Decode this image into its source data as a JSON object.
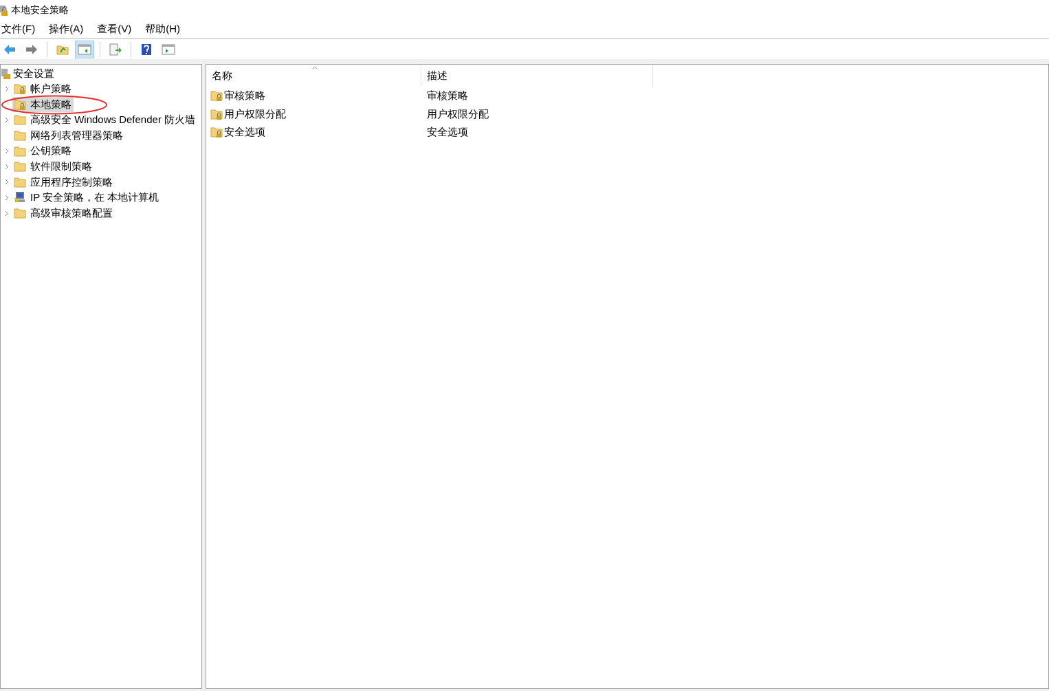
{
  "window": {
    "title": "本地安全策略"
  },
  "menu": [
    "文件(F)",
    "操作(A)",
    "查看(V)",
    "帮助(H)"
  ],
  "toolbar": [
    {
      "kind": "back",
      "selected": false
    },
    {
      "kind": "forward",
      "selected": false
    },
    {
      "kind": "sep"
    },
    {
      "kind": "up",
      "selected": false
    },
    {
      "kind": "tree",
      "selected": true
    },
    {
      "kind": "sep"
    },
    {
      "kind": "export",
      "selected": false
    },
    {
      "kind": "sep"
    },
    {
      "kind": "help",
      "selected": false
    },
    {
      "kind": "pane",
      "selected": false
    }
  ],
  "tree": {
    "label": "安全设置",
    "children": [
      {
        "label": "帐户策略",
        "kind": "locked",
        "expandable": true,
        "selected": false,
        "circled": false
      },
      {
        "label": "本地策略",
        "kind": "locked",
        "expandable": false,
        "selected": true,
        "circled": true
      },
      {
        "label": "高级安全 Windows Defender 防火墙",
        "kind": "folder",
        "expandable": true,
        "selected": false,
        "circled": false
      },
      {
        "label": "网络列表管理器策略",
        "kind": "folder",
        "expandable": false,
        "selected": false,
        "circled": false
      },
      {
        "label": "公钥策略",
        "kind": "folder",
        "expandable": true,
        "selected": false,
        "circled": false
      },
      {
        "label": "软件限制策略",
        "kind": "folder",
        "expandable": true,
        "selected": false,
        "circled": false
      },
      {
        "label": "应用程序控制策略",
        "kind": "folder",
        "expandable": true,
        "selected": false,
        "circled": false
      },
      {
        "label": "IP 安全策略，在 本地计算机",
        "kind": "computer",
        "expandable": true,
        "selected": false,
        "circled": false
      },
      {
        "label": "高级审核策略配置",
        "kind": "folder",
        "expandable": true,
        "selected": false,
        "circled": false
      }
    ]
  },
  "table": {
    "columns": [
      {
        "label": "名称",
        "sorted": true
      },
      {
        "label": "描述",
        "sorted": false
      }
    ],
    "rows": [
      {
        "name": "审核策略",
        "description": "审核策略"
      },
      {
        "name": "用户权限分配",
        "description": "用户权限分配"
      },
      {
        "name": "安全选项",
        "description": "安全选项"
      }
    ]
  }
}
